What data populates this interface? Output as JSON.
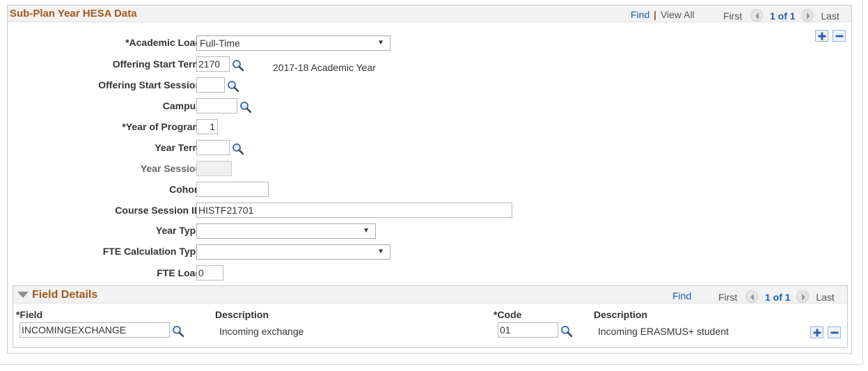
{
  "panel": {
    "title": "Sub-Plan Year HESA Data",
    "nav": {
      "find": "Find",
      "separator": "|",
      "view_all": "View All",
      "first": "First",
      "count": "1 of 1",
      "last": "Last"
    }
  },
  "form": {
    "academic_load": {
      "label": "*Academic Load",
      "value": "Full-Time"
    },
    "offering_start_term": {
      "label": "Offering Start Term",
      "value": "2170",
      "description": "2017-18 Academic Year"
    },
    "offering_start_session": {
      "label": "Offering Start Session",
      "value": ""
    },
    "campus": {
      "label": "Campus",
      "value": ""
    },
    "year_of_program": {
      "label": "*Year of Program",
      "value": "1"
    },
    "year_term": {
      "label": "Year Term",
      "value": ""
    },
    "year_session": {
      "label": "Year Session",
      "value": ""
    },
    "cohort": {
      "label": "Cohort",
      "value": ""
    },
    "course_session_id": {
      "label": "Course Session ID",
      "value": "HISTF21701"
    },
    "year_type": {
      "label": "Year Type",
      "value": ""
    },
    "fte_calculation_type": {
      "label": "FTE Calculation Type",
      "value": ""
    },
    "fte_load": {
      "label": "FTE Load",
      "value": "0"
    }
  },
  "field_details": {
    "title": "Field Details",
    "nav": {
      "find": "Find",
      "first": "First",
      "count": "1 of 1",
      "last": "Last"
    },
    "columns": {
      "field": "*Field",
      "description1": "Description",
      "code": "*Code",
      "description2": "Description"
    },
    "rows": [
      {
        "field": "INCOMINGEXCHANGE",
        "field_description": "Incoming exchange",
        "code": "01",
        "code_description": "Incoming ERASMUS+ student"
      }
    ]
  },
  "icons": {
    "lookup": "magnifier-icon",
    "add": "plus-icon",
    "delete": "minus-icon",
    "previous": "arrow-left-icon",
    "next": "arrow-right-icon",
    "collapse": "triangle-down-icon",
    "dropdown": "chevron-down-icon"
  },
  "colors": {
    "title": "#a25a1e",
    "link": "#1a5da5",
    "header_bg": "#f2f2f2"
  }
}
